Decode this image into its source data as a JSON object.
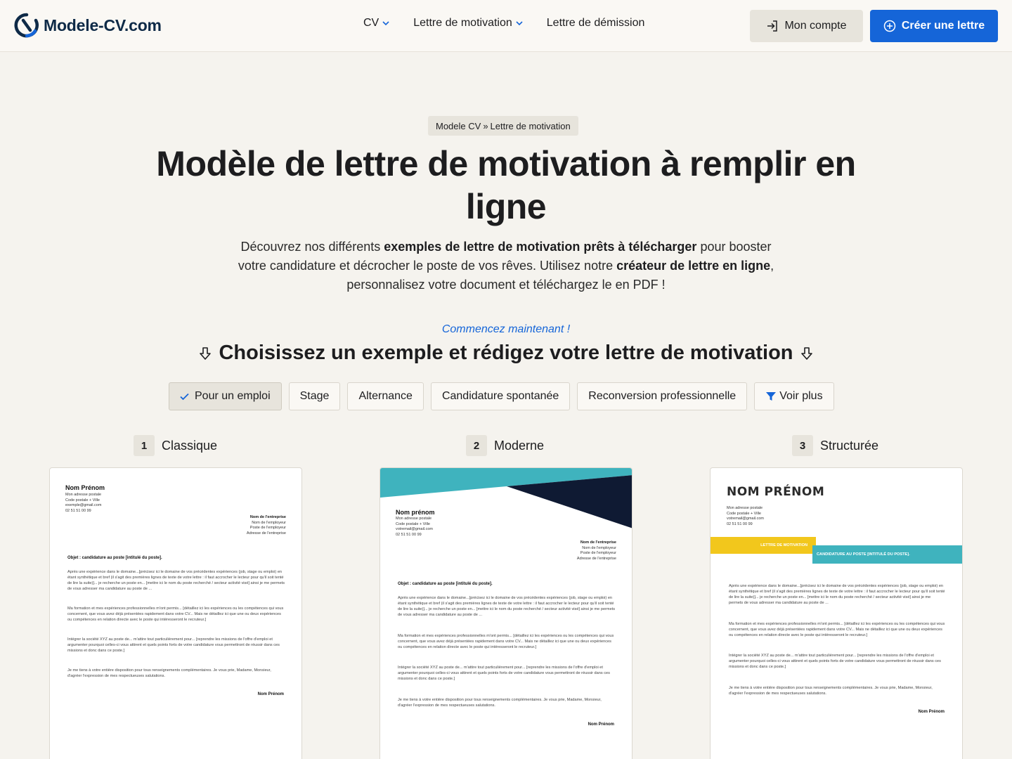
{
  "header": {
    "logo_text": "Modele-CV.com",
    "nav": [
      {
        "label": "CV",
        "has_dropdown": true
      },
      {
        "label": "Lettre de motivation",
        "has_dropdown": true
      },
      {
        "label": "Lettre de démission",
        "has_dropdown": false
      }
    ],
    "account_label": "Mon compte",
    "create_label": "Créer une lettre"
  },
  "breadcrumb": {
    "home": "Modele CV",
    "separator": "»",
    "current": "Lettre de motivation"
  },
  "hero": {
    "title": "Modèle de lettre de motivation à remplir en ligne",
    "intro_1": "Découvrez nos différents ",
    "intro_b1": "exemples de lettre de motivation prêts à télécharger",
    "intro_2": " pour booster votre candidature et décrocher le poste de vos rêves. Utilisez notre ",
    "intro_b2": "créateur de lettre en ligne",
    "intro_3": ", personnalisez votre document et téléchargez le en PDF !",
    "cta": "Commencez maintenant !",
    "subtitle": "Choisissez un exemple et rédigez votre lettre de motivation"
  },
  "filters": [
    {
      "label": "Pour un emploi",
      "active": true
    },
    {
      "label": "Stage",
      "active": false
    },
    {
      "label": "Alternance",
      "active": false
    },
    {
      "label": "Candidature spontanée",
      "active": false
    },
    {
      "label": "Reconversion professionnelle",
      "active": false
    },
    {
      "label": "Voir plus",
      "active": false
    }
  ],
  "templates": [
    {
      "num": "1",
      "name": "Classique"
    },
    {
      "num": "2",
      "name": "Moderne"
    },
    {
      "num": "3",
      "name": "Structurée"
    }
  ],
  "letter": {
    "name": "Nom Prénom",
    "name_alt": "Nom prénom",
    "name_upper": "NOM PRÉNOM",
    "addr1": "Mon adresse postale",
    "addr2": "Code postale + Ville",
    "email1": "exemple@gmail.com",
    "email2": "votremail@gmail.com",
    "phone": "02 51 51 00 99",
    "company": "Nom de l'entreprise",
    "employer": "Nom de l'employeur",
    "employer_post": "Poste de l'employeur",
    "company_addr": "Adresse de l'entreprise",
    "object": "Objet : candidature au poste [intitulé du poste].",
    "band1": "LETTRE DE MOTIVATION",
    "band2": "CANDIDATURE AU POSTE [INTITULÉ DU POSTE].",
    "p1": "Après une expérience dans le domaine...[précisez ici le domaine de vos précédentes expériences (job, stage ou emploi) en étant synthétique et bref (il s'agit des premières lignes de texte de votre lettre : il faut accrocher le lecteur pour qu'il soit tenté de lire la suite)]... je recherche un poste en... [mettre ici le nom du poste recherché / secteur activité visé] ainsi je me permets de vous adresser ma candidature au poste de ...",
    "p2": "Ma formation et mes expériences professionnelles m'ont permis... [détaillez ici les expériences ou les compétences qui vous concernent, que vous avez déjà présentées rapidement dans votre CV... Mais ne détaillez ici que une ou deux expériences ou compétences en relation directe avec le poste qui intéresseront le recruteur.]",
    "p3": "Intégrer la société XYZ au poste de... m'attire tout particulièrement pour... [reprendre les missions de l'offre d'emploi et argumenter pourquoi celles-ci vous attirent et quels points forts de votre candidature vous permettront de réussir dans ces missions et donc dans ce poste.]",
    "p4": "Je me tiens à votre entière disposition pour tous renseignements complémentaires. Je vous prie, Madame, Monsieur, d'agréer l'expression de mes respectueuses salutations."
  },
  "colors": {
    "accent": "#1565d8",
    "navy": "#0e2a47",
    "teal": "#3fb3be",
    "yellow": "#f2c71c",
    "dark": "#0f1a33"
  }
}
